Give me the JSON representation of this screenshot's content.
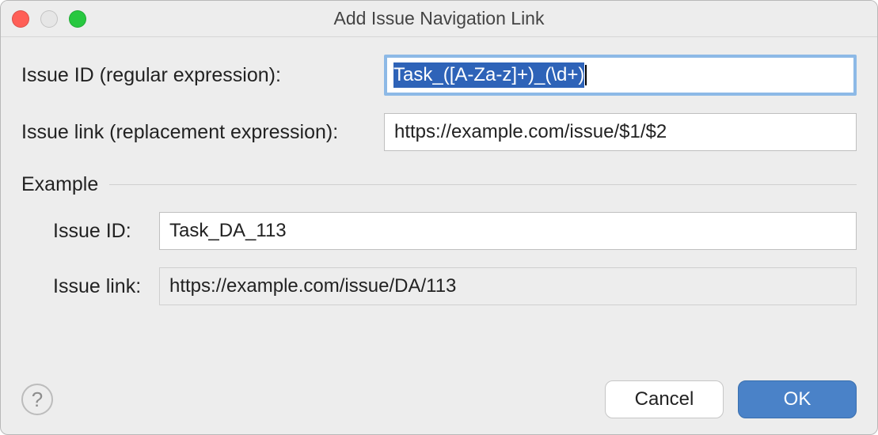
{
  "window": {
    "title": "Add Issue Navigation Link"
  },
  "fields": {
    "issue_id_label": "Issue ID (regular expression):",
    "issue_id_value": "Task_([A-Za-z]+)_(\\d+)",
    "issue_link_label": "Issue link (replacement expression):",
    "issue_link_value": "https://example.com/issue/$1/$2"
  },
  "example": {
    "section_label": "Example",
    "issue_id_label": "Issue ID:",
    "issue_id_value": "Task_DA_113",
    "issue_link_label": "Issue link:",
    "issue_link_value": "https://example.com/issue/DA/113"
  },
  "buttons": {
    "help_icon": "?",
    "cancel": "Cancel",
    "ok": "OK"
  }
}
